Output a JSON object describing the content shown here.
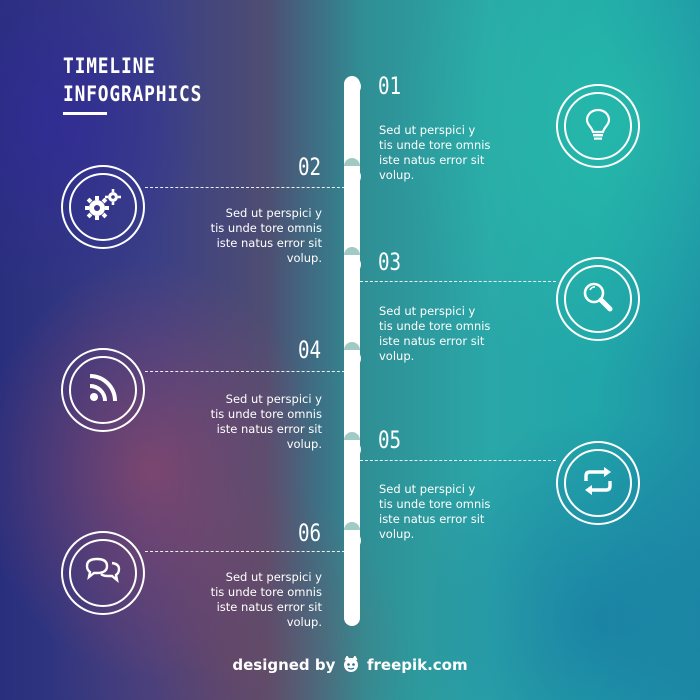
{
  "title": {
    "line1": "TIMELINE",
    "line2": "INFOGRAPHICS"
  },
  "steps": [
    {
      "number": "01",
      "side": "right",
      "icon": "lightbulb-icon",
      "text": [
        "Sed ut perspici y",
        "tis unde tore omnis",
        "iste natus error sit",
        "volup."
      ]
    },
    {
      "number": "02",
      "side": "left",
      "icon": "gears-icon",
      "text": [
        "Sed ut perspici y",
        "tis unde tore omnis",
        "iste natus error sit",
        "volup."
      ]
    },
    {
      "number": "03",
      "side": "right",
      "icon": "search-icon",
      "text": [
        "Sed ut perspici y",
        "tis unde tore omnis",
        "iste natus error sit",
        "volup."
      ]
    },
    {
      "number": "04",
      "side": "left",
      "icon": "rss-icon",
      "text": [
        "Sed ut perspici y",
        "tis unde tore omnis",
        "iste natus error sit",
        "volup."
      ]
    },
    {
      "number": "05",
      "side": "right",
      "icon": "refresh-icon",
      "text": [
        "Sed ut perspici y",
        "tis unde tore omnis",
        "iste natus error sit",
        "volup."
      ]
    },
    {
      "number": "06",
      "side": "left",
      "icon": "chat-bubbles-icon",
      "text": [
        "Sed ut perspici y",
        "tis unde tore omnis",
        "iste natus error sit",
        "volup."
      ]
    }
  ],
  "footer": {
    "prefix": "designed by",
    "brand": "freepik.com"
  }
}
